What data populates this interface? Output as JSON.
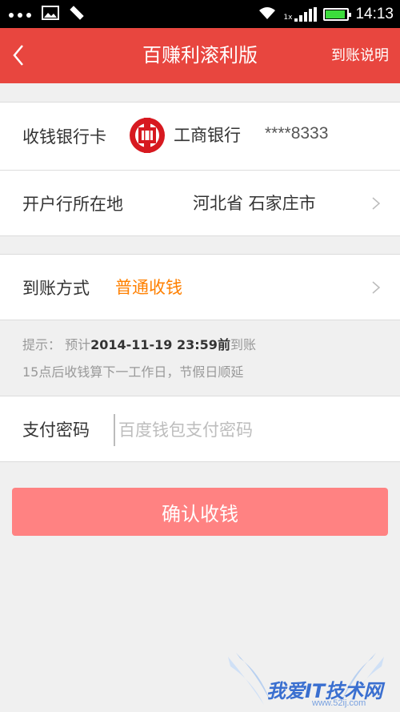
{
  "status_bar": {
    "time": "14:13",
    "signal_label": "1x"
  },
  "header": {
    "title": "百赚利滚利版",
    "help_link": "到账说明"
  },
  "receive_card": {
    "label": "收钱银行卡",
    "bank_name": "工商银行",
    "card_number": "****8333"
  },
  "branch_region": {
    "label": "开户行所在地",
    "value": "河北省 石家庄市"
  },
  "arrival_method": {
    "label": "到账方式",
    "value": "普通收钱"
  },
  "tip": {
    "prefix": "提示： 预计",
    "datetime": "2014-11-19 23:59前",
    "suffix": "到账",
    "line2": "15点后收钱算下一工作日，节假日顺延"
  },
  "payment_password": {
    "label": "支付密码",
    "placeholder": "百度钱包支付密码",
    "value": ""
  },
  "confirm_button": {
    "label": "确认收钱"
  },
  "watermark": {
    "text": "我爱IT技术网",
    "url": "www.52ij.com"
  },
  "colors": {
    "header_bg": "#e8463f",
    "accent_orange": "#ff8000",
    "confirm_bg": "#ff8282",
    "battery_green": "#3cdc3c"
  },
  "status": {
    "battery_level": 0.9
  }
}
